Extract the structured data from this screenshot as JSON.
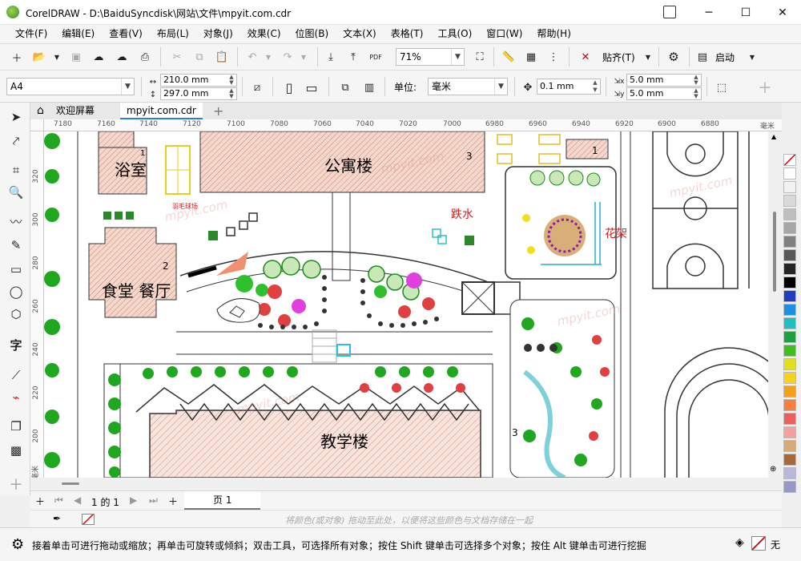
{
  "window": {
    "title": "CorelDRAW - D:\\BaiduSyncdisk\\网站\\文件\\mpyit.com.cdr",
    "minimize": "─",
    "maximize": "☐",
    "close": "✕"
  },
  "menu": [
    "文件(F)",
    "编辑(E)",
    "查看(V)",
    "布局(L)",
    "对象(J)",
    "效果(C)",
    "位图(B)",
    "文本(X)",
    "表格(T)",
    "工具(O)",
    "窗口(W)",
    "帮助(H)"
  ],
  "toolbar1": {
    "zoom": "71%",
    "snap_label": "贴齐(T)",
    "launch_label": "启动",
    "pdf_label": "PDF"
  },
  "toolbar2": {
    "page_size": "A4",
    "width": "210.0 mm",
    "height": "297.0 mm",
    "units_label": "单位:",
    "units": "毫米",
    "nudge": "0.1 mm",
    "dup_x": "5.0 mm",
    "dup_y": "5.0 mm"
  },
  "tabs": {
    "welcome": "欢迎屏幕",
    "document": "mpyit.com.cdr",
    "add": "+"
  },
  "ruler": {
    "h_ticks": [
      "7180",
      "7160",
      "7140",
      "7120",
      "7100",
      "7080",
      "7060",
      "7040",
      "7020",
      "7000",
      "6980",
      "6960",
      "6940",
      "6920",
      "6900",
      "6880"
    ],
    "h_unit": "毫米",
    "v_ticks": [
      "320",
      "300",
      "280",
      "260",
      "240",
      "220",
      "200"
    ],
    "v_unit": "毫米"
  },
  "drawing": {
    "bathroom": "浴室",
    "apartment": "公寓楼",
    "dining": "食堂 餐厅",
    "teaching": "教学楼",
    "rockery": "跌水",
    "trellis": "花架",
    "badminton": "羽毛球场",
    "num1": "1",
    "num2": "2",
    "num3a": "3",
    "num3b": "3",
    "num1b": "1"
  },
  "pagebar": {
    "page_info": "1 的 1",
    "page_tab": "页 1"
  },
  "colorbar": {
    "hint": "将颜色(或对象) 拖动至此处，以便将这些颜色与文档存储在一起"
  },
  "status": {
    "text": "接着单击可进行拖动或缩放；再单击可旋转或倾斜；双击工具，可选择所有对象；按住 Shift 键单击可选择多个对象；按住 Alt 键单击可进行挖掘",
    "fill_label": "无"
  },
  "watermark": "mpyit.com",
  "palette_colors": [
    "#ffffff",
    "#f2f2f2",
    "#d9d9d9",
    "#bfbfbf",
    "#a6a6a6",
    "#808080",
    "#595959",
    "#262626",
    "#000000",
    "#1f3fbf",
    "#1f8fdf",
    "#1fbfbf",
    "#1f9f3f",
    "#3fbf1f",
    "#dfdf1f",
    "#f5d21f",
    "#f59f1f",
    "#f57f3f",
    "#e86060",
    "#f5a0a0",
    "#d8a878",
    "#a86838",
    "#b8b8d8",
    "#9898c8"
  ]
}
